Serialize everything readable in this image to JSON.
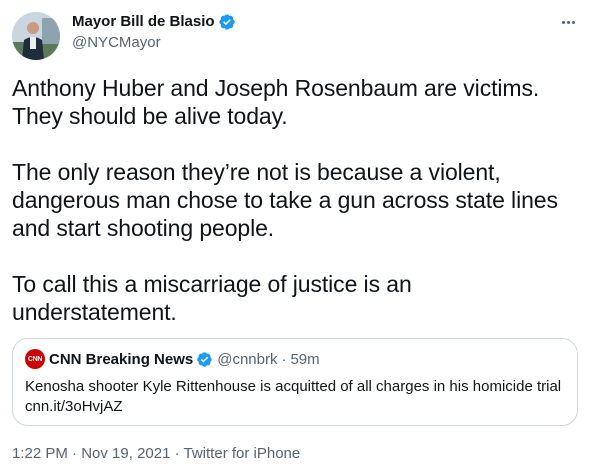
{
  "author": {
    "display_name": "Mayor Bill de Blasio",
    "handle": "@NYCMayor"
  },
  "tweet": {
    "text": "Anthony Huber and Joseph Rosenbaum are victims.\nThey should be alive today.\n\nThe only reason they’re not is because a violent,\ndangerous man chose to take a gun across state lines\nand start shooting people.\n\nTo call this a miscarriage of justice is an\nunderstatement."
  },
  "quoted_tweet": {
    "avatar_text": "CNN",
    "display_name": "CNN Breaking News",
    "handle": "@cnnbrk",
    "separator": "·",
    "time": "59m",
    "text_line1": "Kenosha shooter Kyle Rittenhouse is acquitted of all charges in his homicide trial",
    "text_line2": "cnn.it/3oHvjAZ"
  },
  "meta": {
    "time": "1:22 PM",
    "separator": " · ",
    "date": "Nov 19, 2021",
    "source": "Twitter for iPhone"
  },
  "colors": {
    "verified_blue": "#1d9bf0",
    "cnn_red": "#cc0000",
    "secondary_text": "#536471",
    "border": "#cfd9de"
  },
  "icons": [
    "verified-badge-icon",
    "more-options-icon"
  ]
}
